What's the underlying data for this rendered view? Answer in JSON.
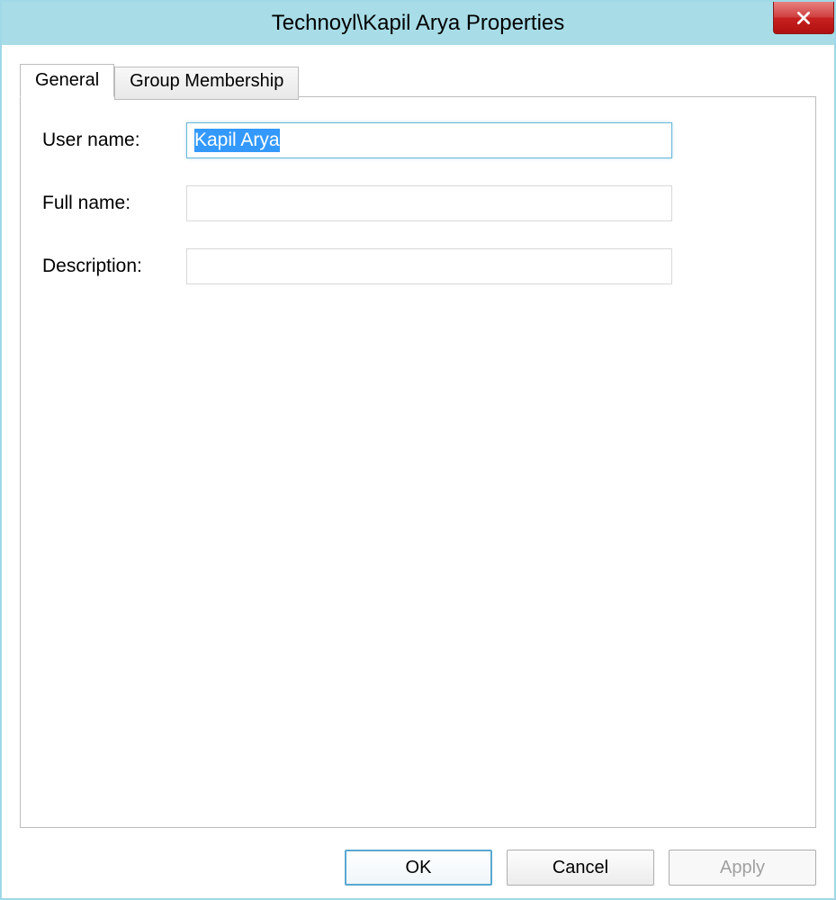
{
  "window": {
    "title": "Technoyl\\Kapil Arya Properties"
  },
  "tabs": [
    {
      "label": "General",
      "active": true
    },
    {
      "label": "Group Membership",
      "active": false
    }
  ],
  "fields": {
    "username": {
      "label": "User name:",
      "value": "Kapil Arya",
      "selected": true
    },
    "fullname": {
      "label": "Full name:",
      "value": ""
    },
    "description": {
      "label": "Description:",
      "value": ""
    }
  },
  "buttons": {
    "ok": "OK",
    "cancel": "Cancel",
    "apply": "Apply"
  }
}
